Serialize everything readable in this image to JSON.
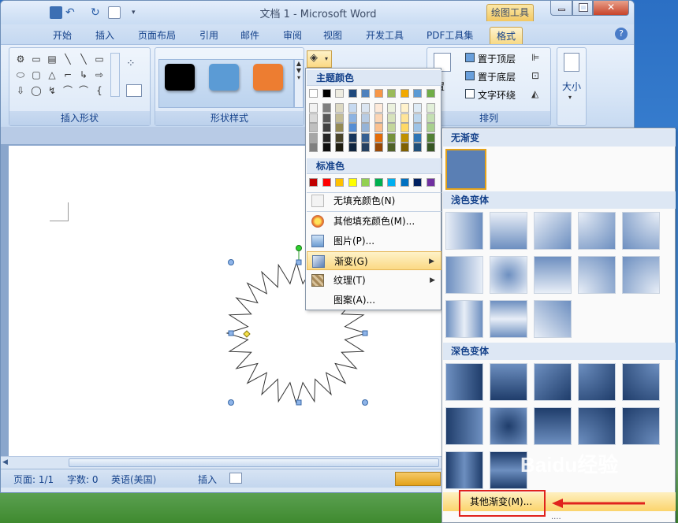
{
  "window": {
    "title": "文档 1 - Microsoft Word",
    "context_tab_group": "绘图工具",
    "close_glyph": "✕"
  },
  "tabs": [
    "开始",
    "插入",
    "页面布局",
    "引用",
    "邮件",
    "审阅",
    "视图",
    "开发工具",
    "PDF工具集",
    "格式"
  ],
  "active_tab": "格式",
  "help_glyph": "?",
  "ribbon": {
    "groups": {
      "insert_shapes": "插入形状",
      "shape_styles": "形状样式",
      "arrange": "排列"
    },
    "arrange_buttons": [
      "置于顶层",
      "置于底层",
      "文字环绕"
    ],
    "arrange_prefix": "置",
    "size_label": "大小",
    "shape_glyphs": [
      "⚙",
      "▭",
      "▤",
      "╲",
      "╲",
      "▭",
      "⬭",
      "▢",
      "△",
      "⌐",
      "↳",
      "⇨",
      "⇩",
      "◯",
      "↯",
      "⌒",
      "⌒",
      "{"
    ],
    "style_swatches": [
      "#000000",
      "#5b9bd5",
      "#ed7d31"
    ]
  },
  "status_bar": {
    "page": "页面: 1/1",
    "words": "字数: 0",
    "language": "英语(美国)",
    "mode": "插入"
  },
  "fill_menu": {
    "theme_colors_header": "主题颜色",
    "standard_colors_header": "标准色",
    "theme_top_row": [
      "#ffffff",
      "#000000",
      "#eeece1",
      "#1f497d",
      "#4f81bd",
      "#f79646",
      "#9bbb59",
      "#f2a900",
      "#5b9bd5",
      "#70ad47"
    ],
    "theme_shade_columns": [
      [
        "#f2f2f2",
        "#d9d9d9",
        "#bfbfbf",
        "#a6a6a6",
        "#808080"
      ],
      [
        "#7f7f7f",
        "#595959",
        "#404040",
        "#262626",
        "#0d0d0d"
      ],
      [
        "#ddd9c3",
        "#c4bd97",
        "#948a54",
        "#4a452a",
        "#1e1c11"
      ],
      [
        "#c6d9f0",
        "#8db3e2",
        "#548dd4",
        "#17365d",
        "#0f243e"
      ],
      [
        "#dbe5f1",
        "#b8cce4",
        "#95b3d7",
        "#366092",
        "#244061"
      ],
      [
        "#fde9d9",
        "#fbd5b5",
        "#fac08f",
        "#e36c09",
        "#974806"
      ],
      [
        "#ebf1dd",
        "#d7e3bc",
        "#c3d69b",
        "#76923c",
        "#4f6128"
      ],
      [
        "#fff2cc",
        "#ffe599",
        "#ffd966",
        "#bf9000",
        "#7f6000"
      ],
      [
        "#deebf6",
        "#bdd7ee",
        "#9dc3e6",
        "#2e75b5",
        "#1f4e79"
      ],
      [
        "#e2efd9",
        "#c5e0b3",
        "#a8d08d",
        "#538135",
        "#375623"
      ]
    ],
    "standard_colors": [
      "#c00000",
      "#ff0000",
      "#ffc000",
      "#ffff00",
      "#92d050",
      "#00b050",
      "#00b0f0",
      "#0070c0",
      "#002060",
      "#7030a0"
    ],
    "items": [
      {
        "label": "无填充颜色(N)",
        "key": "no-fill"
      },
      {
        "label": "其他填充颜色(M)...",
        "key": "more-colors"
      },
      {
        "label": "图片(P)...",
        "key": "picture"
      },
      {
        "label": "渐变(G)",
        "key": "gradient",
        "submenu": true,
        "highlighted": true
      },
      {
        "label": "纹理(T)",
        "key": "texture",
        "submenu": true
      },
      {
        "label": "图案(A)...",
        "key": "pattern"
      }
    ],
    "submenu_arrow": "▶"
  },
  "gradient_menu": {
    "no_gradient_header": "无渐变",
    "light_variations_header": "浅色变体",
    "dark_variations_header": "深色变体",
    "more_gradients": "其他渐变(M)...",
    "more_dots": "....",
    "light_count": 13,
    "dark_count": 12
  },
  "watermark": "Baidu经验",
  "accent": {
    "ribbon_blue": "#15428b",
    "highlight_gold": "#fbd984",
    "gradient_blue": "#5a7fb4",
    "red_annotation": "#e0231d"
  }
}
